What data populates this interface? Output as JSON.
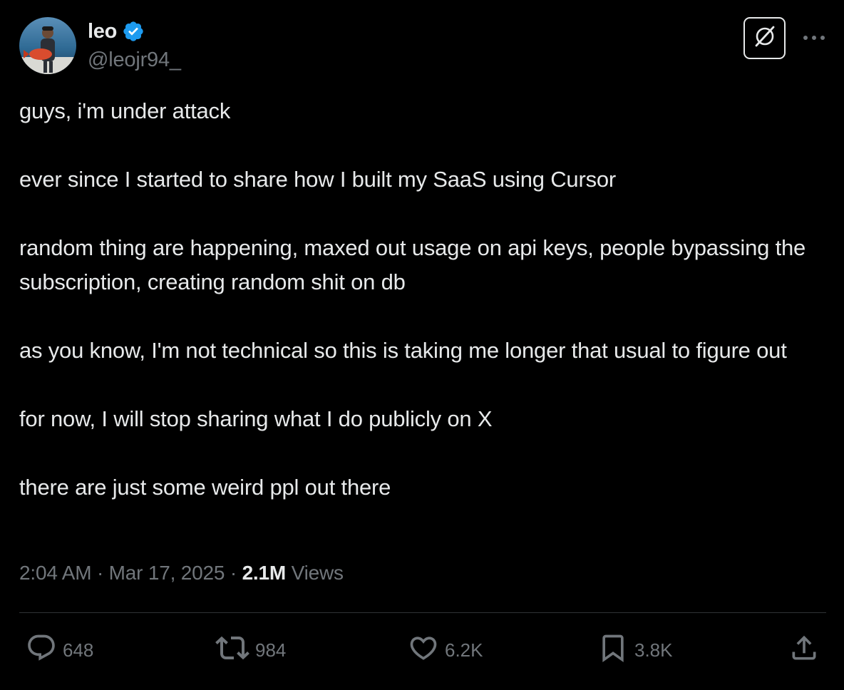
{
  "author": {
    "display_name": "leo",
    "handle": "@leojr94_",
    "verified": true,
    "avatar": "avatar-photo-fisherman-holding-fish"
  },
  "header_actions": {
    "grok_icon": "grok-icon",
    "more_icon": "more-horizontal-icon"
  },
  "tweet": {
    "paragraphs": [
      "guys, i'm under attack",
      "ever since I started to share how I built my SaaS using Cursor",
      "random thing are happening, maxed out usage on api keys, people bypassing the subscription, creating random shit on db",
      "as you know, I'm not technical so this is taking me longer that usual to figure out",
      "for now, I will stop sharing what I do publicly on X",
      "there are just some weird ppl out there"
    ]
  },
  "meta": {
    "time": "2:04 AM",
    "separator": "·",
    "date": "Mar 17, 2025",
    "views_count": "2.1M",
    "views_label": "Views"
  },
  "engagement": {
    "replies": "648",
    "reposts": "984",
    "likes": "6.2K",
    "bookmarks": "3.8K"
  },
  "colors": {
    "background": "#000000",
    "text_primary": "#e7e9ea",
    "text_secondary": "#71767b",
    "verified_blue": "#1d9bf0",
    "divider": "#2f3336"
  }
}
